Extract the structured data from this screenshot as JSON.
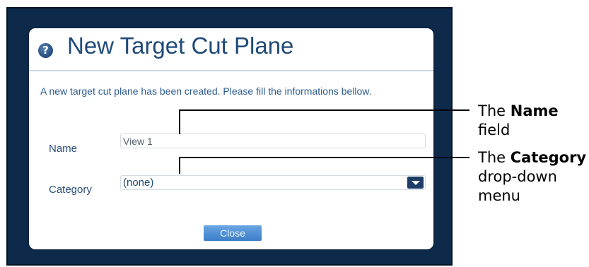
{
  "dialog": {
    "title": "New Target Cut Plane",
    "help_glyph": "?",
    "message": "A new target cut plane has been created. Please fill the informations bellow.",
    "name_label": "Name",
    "name_value": "View 1",
    "category_label": "Category",
    "category_value": "(none)",
    "close_label": "Close"
  },
  "callouts": {
    "name": {
      "prefix": "The",
      "bold": "Name",
      "suffix": "field"
    },
    "category": {
      "prefix": "The",
      "bold": "Category",
      "line2": "drop-down",
      "line3": "menu"
    }
  },
  "colors": {
    "frame": "#0e2a4a",
    "title": "#1f4a78",
    "close_button": "#4f8fd6"
  },
  "icons": [
    "help-icon",
    "chevron-down-icon"
  ]
}
